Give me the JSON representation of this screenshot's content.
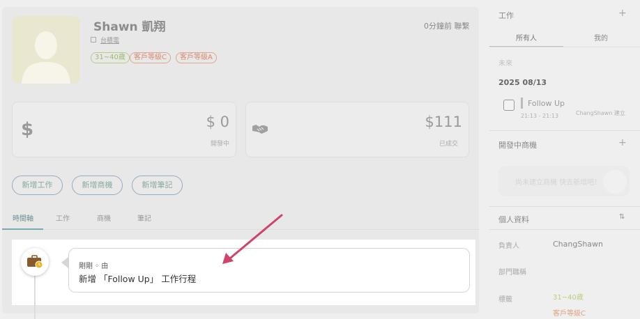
{
  "profile": {
    "name": "Shawn 凱翔",
    "company": "台積電",
    "tags": [
      {
        "label": "31~40歲",
        "color": "#9fb86a"
      },
      {
        "label": "客戶等級C",
        "color": "#d98a70"
      },
      {
        "label": "客戶等級A",
        "color": "#d98a70"
      }
    ],
    "last_contact": "0分鐘前 聯繫"
  },
  "stats": [
    {
      "icon": "dollar-icon",
      "symbol": "$",
      "value": "$ 0",
      "label": "開發中"
    },
    {
      "icon": "handshake-icon",
      "value": "$111",
      "label": "已成交"
    }
  ],
  "actions": [
    "新增工作",
    "新增商機",
    "新增筆記"
  ],
  "tabs": [
    "時間軸",
    "工作",
    "商機",
    "筆記"
  ],
  "timeline": {
    "meta": "剛剛 ◦ 由",
    "text": "新增 「Follow Up」 工作行程"
  },
  "sidebar": {
    "work": {
      "title": "工作",
      "plus": "+",
      "tabs": [
        "所有人",
        "我的"
      ],
      "upcoming": "未來",
      "date": "2025 08/13",
      "task": {
        "title": "Follow Up",
        "time": "21:13 - 21:13",
        "creator": "ChangShawn 建立"
      }
    },
    "deals": {
      "title": "開發中商機",
      "plus": "+",
      "empty": "尚未建立商機 快去新增吧！"
    },
    "personal": {
      "title": "個人資料",
      "sort": "⇅",
      "rows": [
        {
          "key": "負責人",
          "value": "ChangShawn"
        },
        {
          "key": "部門職稱",
          "value": ""
        },
        {
          "key": "標籤",
          "values": [
            {
              "text": "31~40歲",
              "color": "#b9cf7a"
            },
            {
              "text": "客戶等級C",
              "color": "#e3a07f"
            }
          ]
        }
      ]
    }
  },
  "colors": {
    "accent": "#d0436a",
    "teal": "#7aa"
  }
}
